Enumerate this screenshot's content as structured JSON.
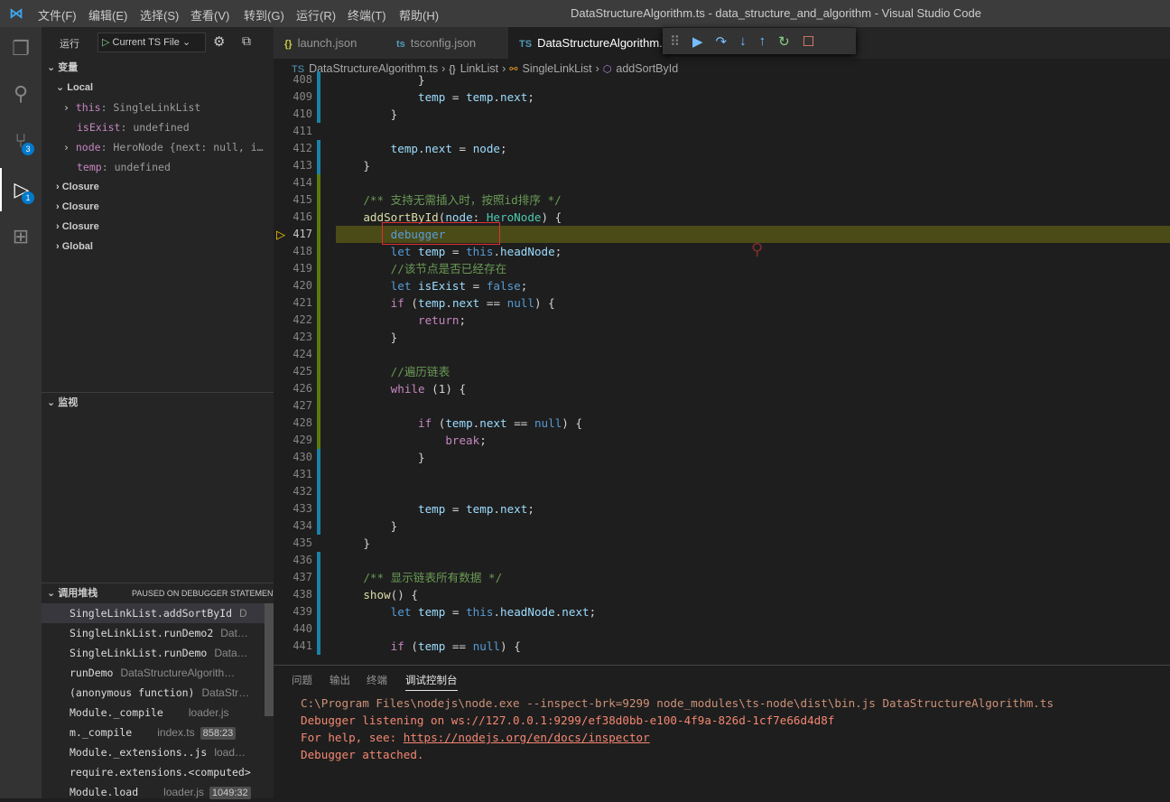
{
  "titlebar": {
    "menus": [
      "文件(F)",
      "编辑(E)",
      "选择(S)",
      "查看(V)",
      "转到(G)",
      "运行(R)",
      "终端(T)",
      "帮助(H)"
    ],
    "title": "DataStructureAlgorithm.ts - data_structure_and_algorithm - Visual Studio Code"
  },
  "activity": {
    "scm_badge": "3",
    "debug_badge": "1"
  },
  "sidebar": {
    "run_label": "运行",
    "config": "Current TS File",
    "variables_title": "变量",
    "local": "Local",
    "vars": [
      {
        "name": "this",
        "value": "SingleLinkList",
        "expandable": true
      },
      {
        "name": "isExist",
        "value": "undefined",
        "expandable": false
      },
      {
        "name": "node",
        "value": "HeroNode {next: null, i…",
        "expandable": true
      },
      {
        "name": "temp",
        "value": "undefined",
        "expandable": false
      }
    ],
    "scopes": [
      "Closure",
      "Closure",
      "Closure",
      "Global"
    ],
    "watch_title": "监视",
    "callstack_title": "调用堆栈",
    "callstack_status": "PAUSED ON DEBUGGER STATEMENT",
    "frames": [
      {
        "name": "SingleLinkList.addSortById",
        "file": "D",
        "pos": ""
      },
      {
        "name": "SingleLinkList.runDemo2",
        "file": "Dat…",
        "pos": ""
      },
      {
        "name": "SingleLinkList.runDemo",
        "file": "Data…",
        "pos": ""
      },
      {
        "name": "runDemo",
        "file": "DataStructureAlgorith…",
        "pos": ""
      },
      {
        "name": "(anonymous function)",
        "file": "DataStr…",
        "pos": ""
      },
      {
        "name": "Module._compile",
        "file": "loader.js",
        "pos": ""
      },
      {
        "name": "m._compile",
        "file": "index.ts",
        "pos": "858:23"
      },
      {
        "name": "Module._extensions..js",
        "file": "load…",
        "pos": ""
      },
      {
        "name": "require.extensions.<computed>",
        "file": "",
        "pos": ""
      },
      {
        "name": "Module.load",
        "file": "loader.js",
        "pos": "1049:32"
      }
    ]
  },
  "tabs": [
    {
      "label": "launch.json",
      "icon": "{}"
    },
    {
      "label": "tsconfig.json",
      "icon": "ts"
    },
    {
      "label": "DataStructureAlgorithm.",
      "icon": "TS"
    }
  ],
  "breadcrumb": [
    "DataStructureAlgorithm.ts",
    "LinkList",
    "SingleLinkList",
    "addSortById"
  ],
  "editor": {
    "current_line": 417,
    "lines": [
      [
        408,
        [
          [
            "pl",
            "            }"
          ]
        ]
      ],
      [
        409,
        [
          [
            "var",
            "            temp"
          ],
          [
            "pl",
            " = "
          ],
          [
            "var",
            "temp"
          ],
          [
            "pl",
            "."
          ],
          [
            "var",
            "next"
          ],
          [
            "pl",
            ";"
          ]
        ]
      ],
      [
        410,
        [
          [
            "pl",
            "        }"
          ]
        ]
      ],
      [
        411,
        []
      ],
      [
        412,
        [
          [
            "var",
            "        temp"
          ],
          [
            "pl",
            "."
          ],
          [
            "var",
            "next"
          ],
          [
            "pl",
            " = "
          ],
          [
            "var",
            "node"
          ],
          [
            "pl",
            ";"
          ]
        ]
      ],
      [
        413,
        [
          [
            "pl",
            "    }"
          ]
        ]
      ],
      [
        414,
        []
      ],
      [
        415,
        [
          [
            "cm",
            "    /** 支持无需插入时，按照id排序 */"
          ]
        ]
      ],
      [
        416,
        [
          [
            "fn",
            "    addSortById"
          ],
          [
            "pl",
            "("
          ],
          [
            "var",
            "node"
          ],
          [
            "pl",
            ": "
          ],
          [
            "ty",
            "HeroNode"
          ],
          [
            "pl",
            ") {"
          ]
        ]
      ],
      [
        417,
        [
          [
            "kw",
            "        debugger"
          ]
        ]
      ],
      [
        418,
        [
          [
            "kw",
            "        let "
          ],
          [
            "var",
            "temp"
          ],
          [
            "pl",
            " = "
          ],
          [
            "kw",
            "this"
          ],
          [
            "pl",
            "."
          ],
          [
            "var",
            "headNode"
          ],
          [
            "pl",
            ";"
          ]
        ]
      ],
      [
        419,
        [
          [
            "cm",
            "        //该节点是否已经存在"
          ]
        ]
      ],
      [
        420,
        [
          [
            "kw",
            "        let "
          ],
          [
            "var",
            "isExist"
          ],
          [
            "pl",
            " = "
          ],
          [
            "kw",
            "false"
          ],
          [
            "pl",
            ";"
          ]
        ]
      ],
      [
        421,
        [
          [
            "ctl",
            "        if"
          ],
          [
            "pl",
            " ("
          ],
          [
            "var",
            "temp"
          ],
          [
            "pl",
            "."
          ],
          [
            "var",
            "next"
          ],
          [
            "pl",
            " == "
          ],
          [
            "kw",
            "null"
          ],
          [
            "pl",
            ") {"
          ]
        ]
      ],
      [
        422,
        [
          [
            "ctl",
            "            return"
          ],
          [
            "pl",
            ";"
          ]
        ]
      ],
      [
        423,
        [
          [
            "pl",
            "        }"
          ]
        ]
      ],
      [
        424,
        []
      ],
      [
        425,
        [
          [
            "cm",
            "        //遍历链表"
          ]
        ]
      ],
      [
        426,
        [
          [
            "ctl",
            "        while"
          ],
          [
            "pl",
            " (1) {"
          ]
        ]
      ],
      [
        427,
        []
      ],
      [
        428,
        [
          [
            "ctl",
            "            if"
          ],
          [
            "pl",
            " ("
          ],
          [
            "var",
            "temp"
          ],
          [
            "pl",
            "."
          ],
          [
            "var",
            "next"
          ],
          [
            "pl",
            " == "
          ],
          [
            "kw",
            "null"
          ],
          [
            "pl",
            ") {"
          ]
        ]
      ],
      [
        429,
        [
          [
            "ctl",
            "                break"
          ],
          [
            "pl",
            ";"
          ]
        ]
      ],
      [
        430,
        [
          [
            "pl",
            "            }"
          ]
        ]
      ],
      [
        431,
        []
      ],
      [
        432,
        []
      ],
      [
        433,
        [
          [
            "var",
            "            temp"
          ],
          [
            "pl",
            " = "
          ],
          [
            "var",
            "temp"
          ],
          [
            "pl",
            "."
          ],
          [
            "var",
            "next"
          ],
          [
            "pl",
            ";"
          ]
        ]
      ],
      [
        434,
        [
          [
            "pl",
            "        }"
          ]
        ]
      ],
      [
        435,
        [
          [
            "pl",
            "    }"
          ]
        ]
      ],
      [
        436,
        []
      ],
      [
        437,
        [
          [
            "cm",
            "    /** 显示链表所有数据 */"
          ]
        ]
      ],
      [
        438,
        [
          [
            "fn",
            "    show"
          ],
          [
            "pl",
            "() {"
          ]
        ]
      ],
      [
        439,
        [
          [
            "kw",
            "        let "
          ],
          [
            "var",
            "temp"
          ],
          [
            "pl",
            " = "
          ],
          [
            "kw",
            "this"
          ],
          [
            "pl",
            "."
          ],
          [
            "var",
            "headNode"
          ],
          [
            "pl",
            "."
          ],
          [
            "var",
            "next"
          ],
          [
            "pl",
            ";"
          ]
        ]
      ],
      [
        440,
        []
      ],
      [
        441,
        [
          [
            "ctl",
            "        if"
          ],
          [
            "pl",
            " ("
          ],
          [
            "var",
            "temp"
          ],
          [
            "pl",
            " == "
          ],
          [
            "kw",
            "null"
          ],
          [
            "pl",
            ") {"
          ]
        ]
      ]
    ]
  },
  "panel": {
    "tabs": [
      "问题",
      "输出",
      "终端",
      "调试控制台"
    ],
    "active": 3,
    "console": [
      "C:\\Program Files\\nodejs\\node.exe --inspect-brk=9299 node_modules\\ts-node\\dist\\bin.js DataStructureAlgorithm.ts",
      "Debugger listening on ws://127.0.0.1:9299/ef38d0bb-e100-4f9a-826d-1cf7e66d4d8f",
      "For help, see: ",
      "https://nodejs.org/en/docs/inspector",
      "Debugger attached."
    ]
  },
  "colors": {
    "accent": "#007acc",
    "current_line": "#4b4b18",
    "console_text": "#f48771",
    "modified_gutter": "#1b81a8",
    "added_gutter": "#587c0c"
  }
}
